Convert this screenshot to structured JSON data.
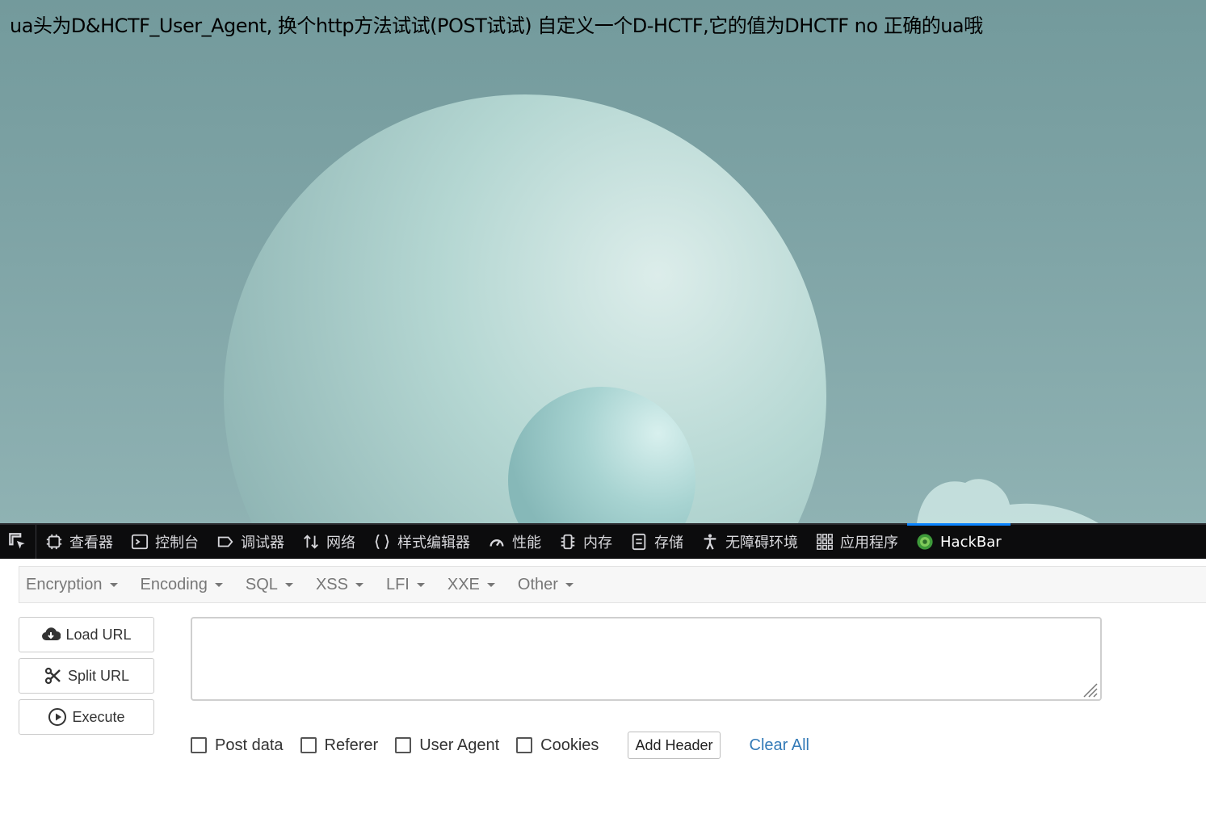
{
  "page": {
    "message": "ua头为D&HCTF_User_Agent, 换个http方法试试(POST试试) 自定义一个D-HCTF,它的值为DHCTF no 正确的ua哦"
  },
  "devtools": {
    "tabs": [
      {
        "label": "查看器",
        "icon": "inspector-icon"
      },
      {
        "label": "控制台",
        "icon": "console-icon"
      },
      {
        "label": "调试器",
        "icon": "debugger-icon"
      },
      {
        "label": "网络",
        "icon": "network-icon"
      },
      {
        "label": "样式编辑器",
        "icon": "style-editor-icon"
      },
      {
        "label": "性能",
        "icon": "performance-icon"
      },
      {
        "label": "内存",
        "icon": "memory-icon"
      },
      {
        "label": "存储",
        "icon": "storage-icon"
      },
      {
        "label": "无障碍环境",
        "icon": "accessibility-icon"
      },
      {
        "label": "应用程序",
        "icon": "application-icon"
      },
      {
        "label": "HackBar",
        "icon": "hackbar-icon",
        "active": true
      }
    ]
  },
  "hackbar": {
    "menu": [
      "Encryption",
      "Encoding",
      "SQL",
      "XSS",
      "LFI",
      "XXE",
      "Other"
    ],
    "load_url": "Load URL",
    "split_url": "Split URL",
    "execute": "Execute",
    "url_value": "",
    "options": {
      "post_data": "Post data",
      "referer": "Referer",
      "user_agent": "User Agent",
      "cookies": "Cookies"
    },
    "add_header": "Add Header",
    "clear_all": "Clear All"
  },
  "colors": {
    "devtools_bg": "#0c0c0d",
    "active_tab_indicator": "#0a84ff",
    "link": "#337ab7",
    "page_bg": "#7fa4a6"
  }
}
